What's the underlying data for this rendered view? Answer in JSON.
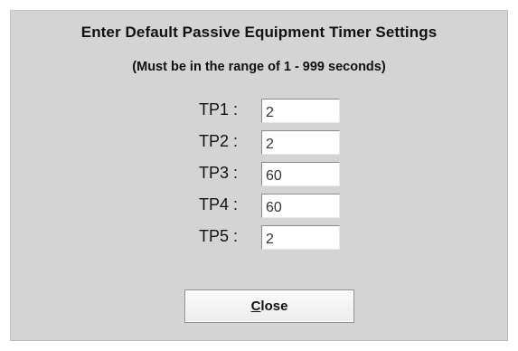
{
  "dialog": {
    "title": "Enter Default Passive Equipment Timer Settings",
    "subtitle": "(Must be in the range of 1 - 999 seconds)",
    "fields": [
      {
        "label": "TP1 :",
        "value": "2"
      },
      {
        "label": "TP2 :",
        "value": "2"
      },
      {
        "label": "TP3 :",
        "value": "60"
      },
      {
        "label": "TP4 :",
        "value": "60"
      },
      {
        "label": "TP5 :",
        "value": "2"
      }
    ],
    "close_button": {
      "mnemonic": "C",
      "rest": "lose"
    }
  }
}
